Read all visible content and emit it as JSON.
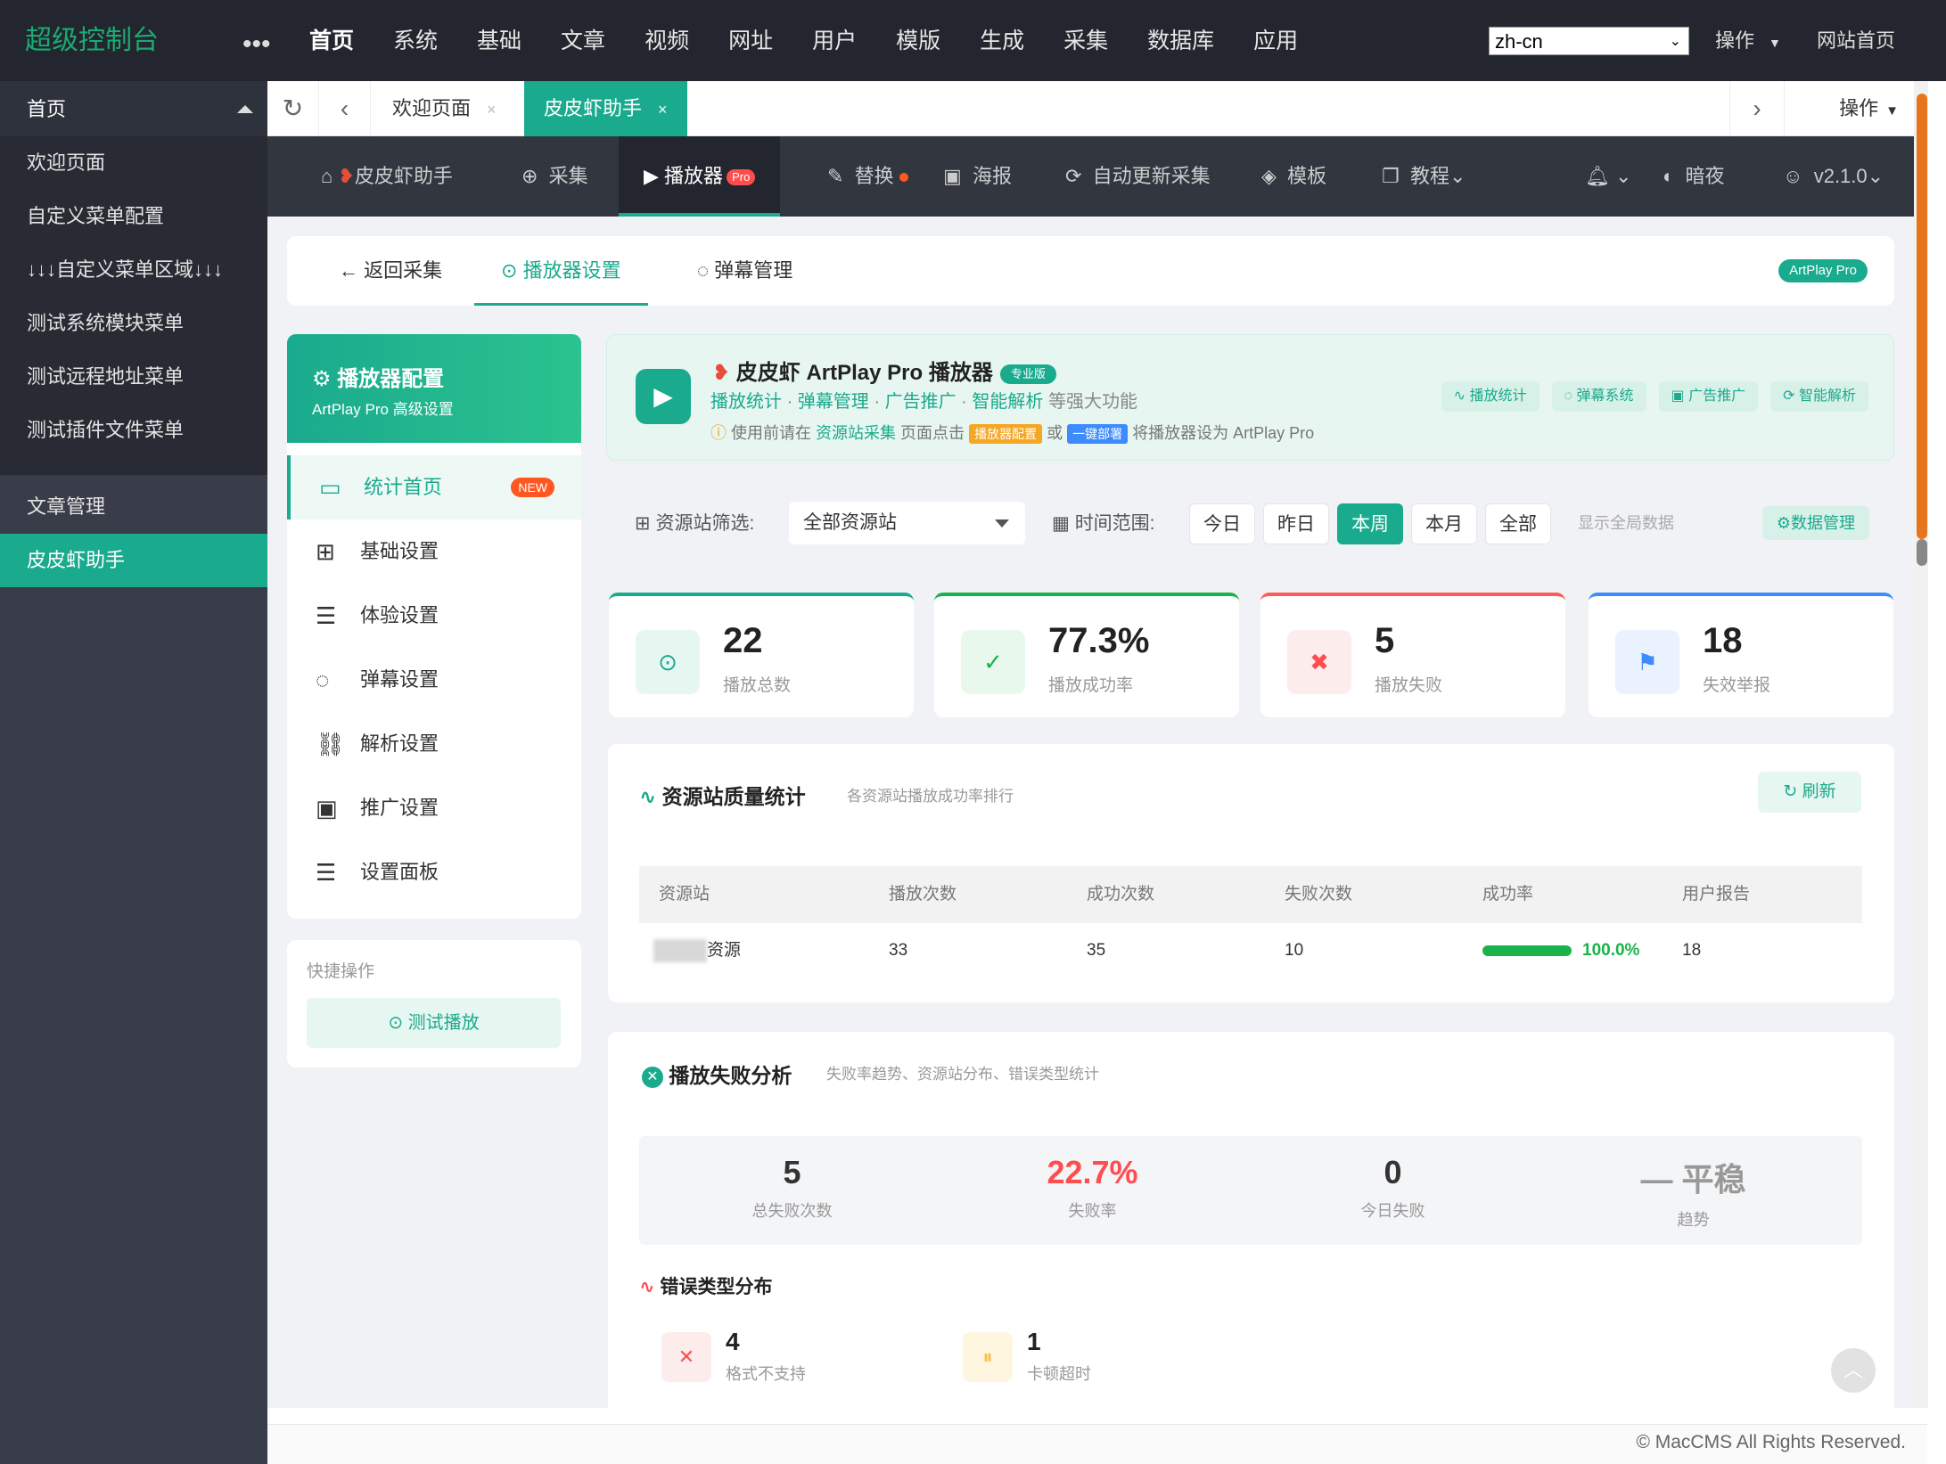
{
  "topbar": {
    "logo": "超级控制台",
    "more": "•••",
    "nav": [
      "首页",
      "系统",
      "基础",
      "文章",
      "视频",
      "网址",
      "用户",
      "模版",
      "生成",
      "采集",
      "数据库",
      "应用"
    ],
    "lang": "zh-cn",
    "ops": "操作",
    "site": "网站首页"
  },
  "sidebar": {
    "group": "首页",
    "items": [
      "欢迎页面",
      "自定义菜单配置",
      "↓↓↓自定义菜单区域↓↓↓",
      "测试系统模块菜单",
      "测试远程地址菜单",
      "测试插件文件菜单"
    ],
    "item2": "文章管理",
    "active": "皮皮虾助手"
  },
  "tabs": {
    "welcome": "欢迎页面",
    "active": "皮皮虾助手",
    "close": "×",
    "ops": "操作"
  },
  "subnav": {
    "home": "皮皮虾助手",
    "collect": "采集",
    "player": "播放器",
    "pro": "Pro",
    "replace": "替换",
    "poster": "海报",
    "auto": "自动更新采集",
    "template": "模板",
    "tutorial": "教程",
    "night": "暗夜",
    "version": "v2.1.0"
  },
  "pagehdr": {
    "back": "返回采集",
    "player_settings": "播放器设置",
    "danmaku": "弹幕管理",
    "badge": "ArtPlay Pro"
  },
  "leftpanel": {
    "title": "播放器配置",
    "subtitle": "ArtPlay Pro 高级设置",
    "menu": [
      "统计首页",
      "基础设置",
      "体验设置",
      "弹幕设置",
      "解析设置",
      "推广设置",
      "设置面板"
    ],
    "new": "NEW",
    "quick_title": "快捷操作",
    "quick_btn": "测试播放"
  },
  "info": {
    "title": "皮皮虾 ArtPlay Pro 播放器",
    "badge": "专业版",
    "features": [
      "播放统计",
      "弹幕管理",
      "广告推广",
      "智能解析"
    ],
    "more": "等强大功能",
    "tip_1": "使用前请在",
    "tip_link": "资源站采集",
    "tip_2": "页面点击",
    "tag_cfg": "播放器配置",
    "tip_or": "或",
    "tag_deploy": "一键部署",
    "tip_3": "将播放器设为 ArtPlay Pro",
    "chips": [
      "播放统计",
      "弹幕系统",
      "广告推广",
      "智能解析"
    ]
  },
  "filter": {
    "source_label": "资源站筛选:",
    "source_value": "全部资源站",
    "time_label": "时间范围:",
    "ranges": [
      "今日",
      "昨日",
      "本周",
      "本月",
      "全部"
    ],
    "active_range": "本周",
    "global": "显示全局数据",
    "data_mgr": "数据管理"
  },
  "stats": [
    {
      "value": "22",
      "label": "播放总数",
      "color": "#1aaa8e"
    },
    {
      "value": "77.3%",
      "label": "播放成功率",
      "color": "#1ab34a"
    },
    {
      "value": "5",
      "label": "播放失败",
      "color": "#ff5b5b"
    },
    {
      "value": "18",
      "label": "失效举报",
      "color": "#3d8bfd"
    }
  ],
  "quality": {
    "title": "资源站质量统计",
    "subtitle": "各资源站播放成功率排行",
    "refresh": "刷新",
    "headers": [
      "资源站",
      "播放次数",
      "成功次数",
      "失败次数",
      "成功率",
      "用户报告"
    ],
    "rows": [
      {
        "name": "资源",
        "plays": "33",
        "success": "35",
        "fail": "10",
        "rate": "100.0%",
        "rate_value": 100,
        "reports": "18"
      }
    ]
  },
  "failure": {
    "title": "播放失败分析",
    "subtitle": "失败率趋势、资源站分布、错误类型统计",
    "summary": [
      {
        "value": "5",
        "label": "总失败次数"
      },
      {
        "value": "22.7%",
        "label": "失败率"
      },
      {
        "value": "0",
        "label": "今日失败"
      },
      {
        "value": "— 平稳",
        "label": "趋势"
      }
    ],
    "error_title": "错误类型分布",
    "errors": [
      {
        "value": "4",
        "label": "格式不支持"
      },
      {
        "value": "1",
        "label": "卡顿超时"
      }
    ]
  },
  "footer": "© MacCMS All Rights Reserved."
}
